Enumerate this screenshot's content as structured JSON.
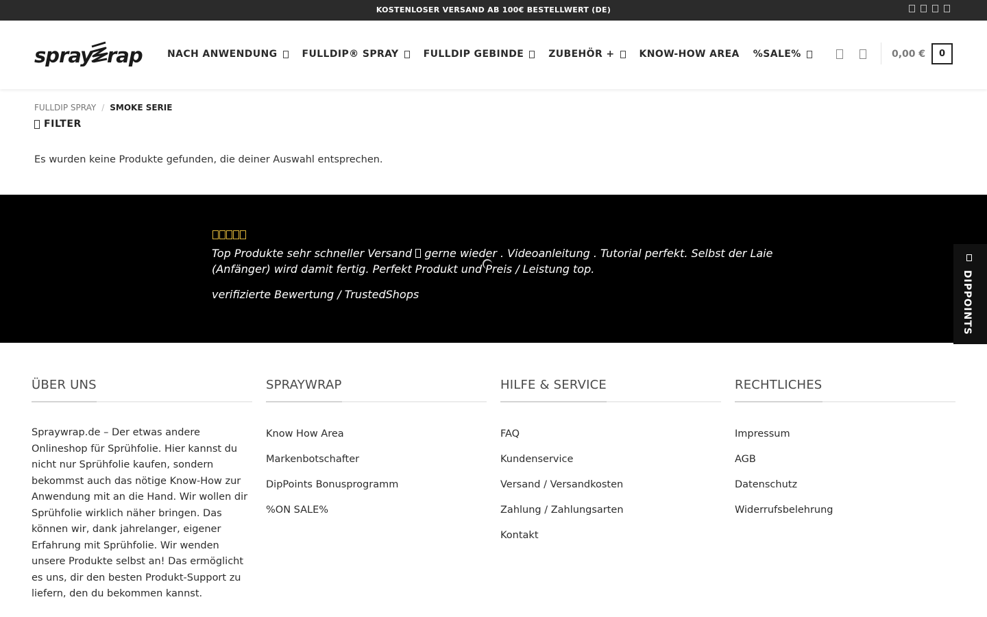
{
  "topbar": {
    "message": "KOSTENLOSER VERSAND AB 100€ BESTELLWERT (DE)",
    "socials": [
      "facebook-icon",
      "instagram-icon",
      "youtube-icon",
      "tiktok-icon"
    ]
  },
  "header": {
    "logo_left": "spray",
    "logo_right": "rap",
    "nav": [
      {
        "label": "NACH ANWENDUNG",
        "has_dropdown": true
      },
      {
        "label": "FULLDIP® SPRAY",
        "has_dropdown": true
      },
      {
        "label": "FULLDIP GEBINDE",
        "has_dropdown": true
      },
      {
        "label": "ZUBEHÖR +",
        "has_dropdown": true
      },
      {
        "label": "KNOW-HOW AREA",
        "has_dropdown": false
      },
      {
        "label": "%SALE%",
        "has_dropdown": true
      }
    ],
    "cart_total": "0,00 €",
    "cart_count": "0"
  },
  "breadcrumb": {
    "parent": "FULLDIP SPRAY",
    "separator": "/",
    "current": "SMOKE SERIE"
  },
  "filter_label": "FILTER",
  "no_results": "Es wurden keine Produkte gefunden, die deiner Auswahl entsprechen.",
  "review": {
    "rating": 5,
    "text_before_icon": "Top Produkte sehr schneller Versand",
    "text_after_icon": "gerne wieder . Videoanleitung . Tutorial perfekt. Selbst der Laie (Anfänger) wird damit fertig. Perfekt Produkt und Preis / Leistung top.",
    "source": "verifizierte Bewertung / TrustedShops",
    "star_color": "#e0b73a"
  },
  "dippoints_tab": "DIPPOINTS",
  "footer": {
    "about": {
      "title": "ÜBER UNS",
      "text": "Spraywrap.de – Der etwas andere Onlineshop für Sprühfolie. Hier kannst du nicht nur Sprühfolie kaufen, sondern bekommst auch das nötige Know-How zur Anwendung mit an die Hand. Wir wollen dir Sprühfolie wirklich näher bringen. Das können wir, dank jahrelanger, eigener Erfahrung mit Sprühfolie. Wir wenden unsere Produkte selbst an! Das ermöglicht es uns, dir den besten Produkt-Support zu liefern, den du bekommen kannst."
    },
    "spraywrap": {
      "title": "SPRAYWRAP",
      "links": [
        "Know How Area",
        "Markenbotschafter",
        "DipPoints Bonusprogramm",
        "%ON SALE%"
      ]
    },
    "service": {
      "title": "HILFE & SERVICE",
      "links": [
        "FAQ",
        "Kundenservice",
        "Versand / Versandkosten",
        "Zahlung / Zahlungsarten",
        "Kontakt"
      ]
    },
    "legal": {
      "title": "RECHTLICHES",
      "links": [
        "Impressum",
        "AGB",
        "Datenschutz",
        "Widerrufsbelehrung"
      ]
    }
  }
}
